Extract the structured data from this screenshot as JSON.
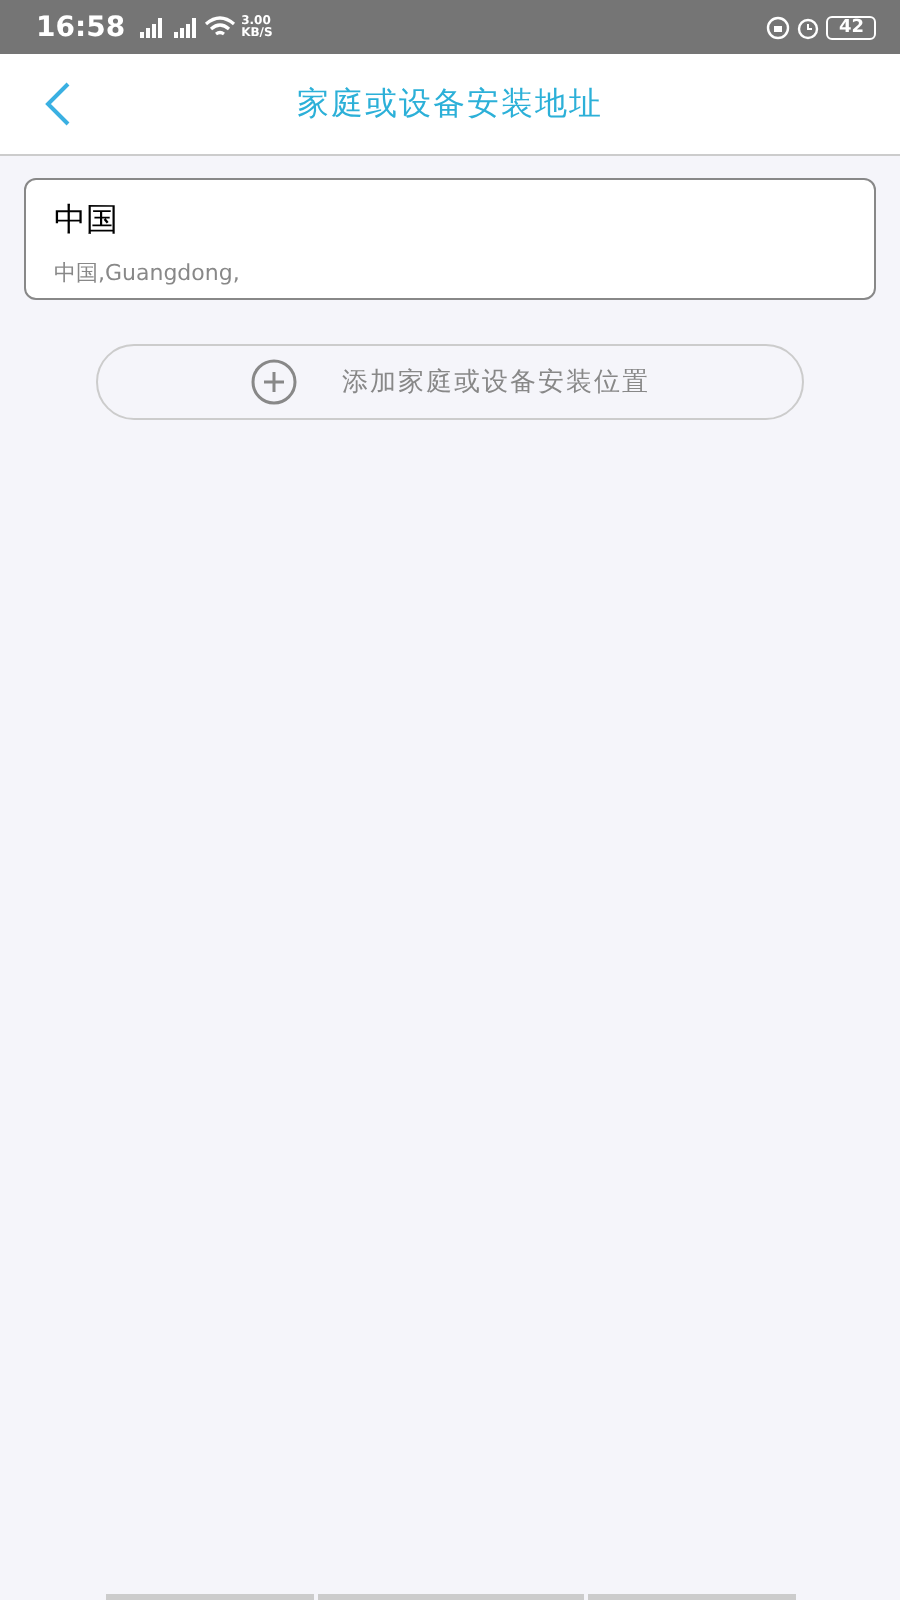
{
  "status_bar": {
    "time": "16:58",
    "net_speed": "3.00",
    "net_unit": "KB/S",
    "battery": "42"
  },
  "header": {
    "title": "家庭或设备安装地址"
  },
  "addresses": [
    {
      "name": "中国",
      "detail": "中国,Guangdong,"
    }
  ],
  "add_button": {
    "label": "添加家庭或设备安装位置"
  }
}
